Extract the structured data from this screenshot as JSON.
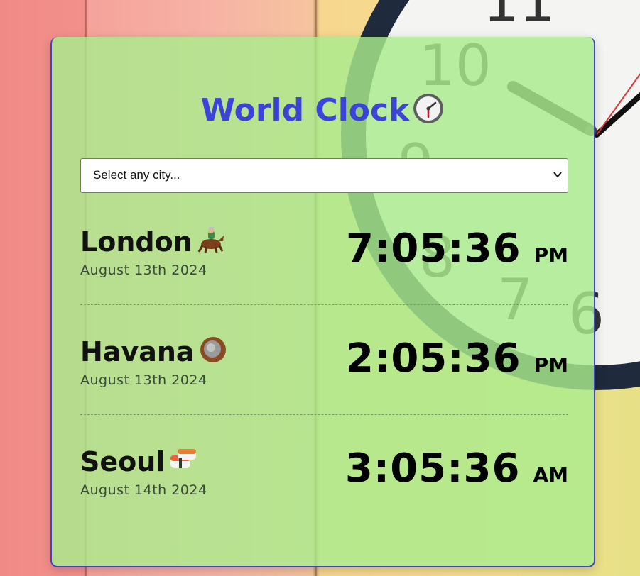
{
  "app": {
    "title": "World Clock",
    "title_icon": "mantelpiece-clock-emoji",
    "accent_color": "#3c44d8",
    "card_color": "#aaec8c"
  },
  "city_select": {
    "placeholder": "Select any city..."
  },
  "cities": [
    {
      "name": "London",
      "icon": "horse-racing-emoji",
      "date": "August 13th 2024",
      "time": "7:05:36",
      "ampm": "PM"
    },
    {
      "name": "Havana",
      "icon": "coconut-emoji",
      "date": "August 13th 2024",
      "time": "2:05:36",
      "ampm": "PM"
    },
    {
      "name": "Seoul",
      "icon": "sushi-emoji",
      "date": "August 14th 2024",
      "time": "3:05:36",
      "ampm": "AM"
    }
  ]
}
